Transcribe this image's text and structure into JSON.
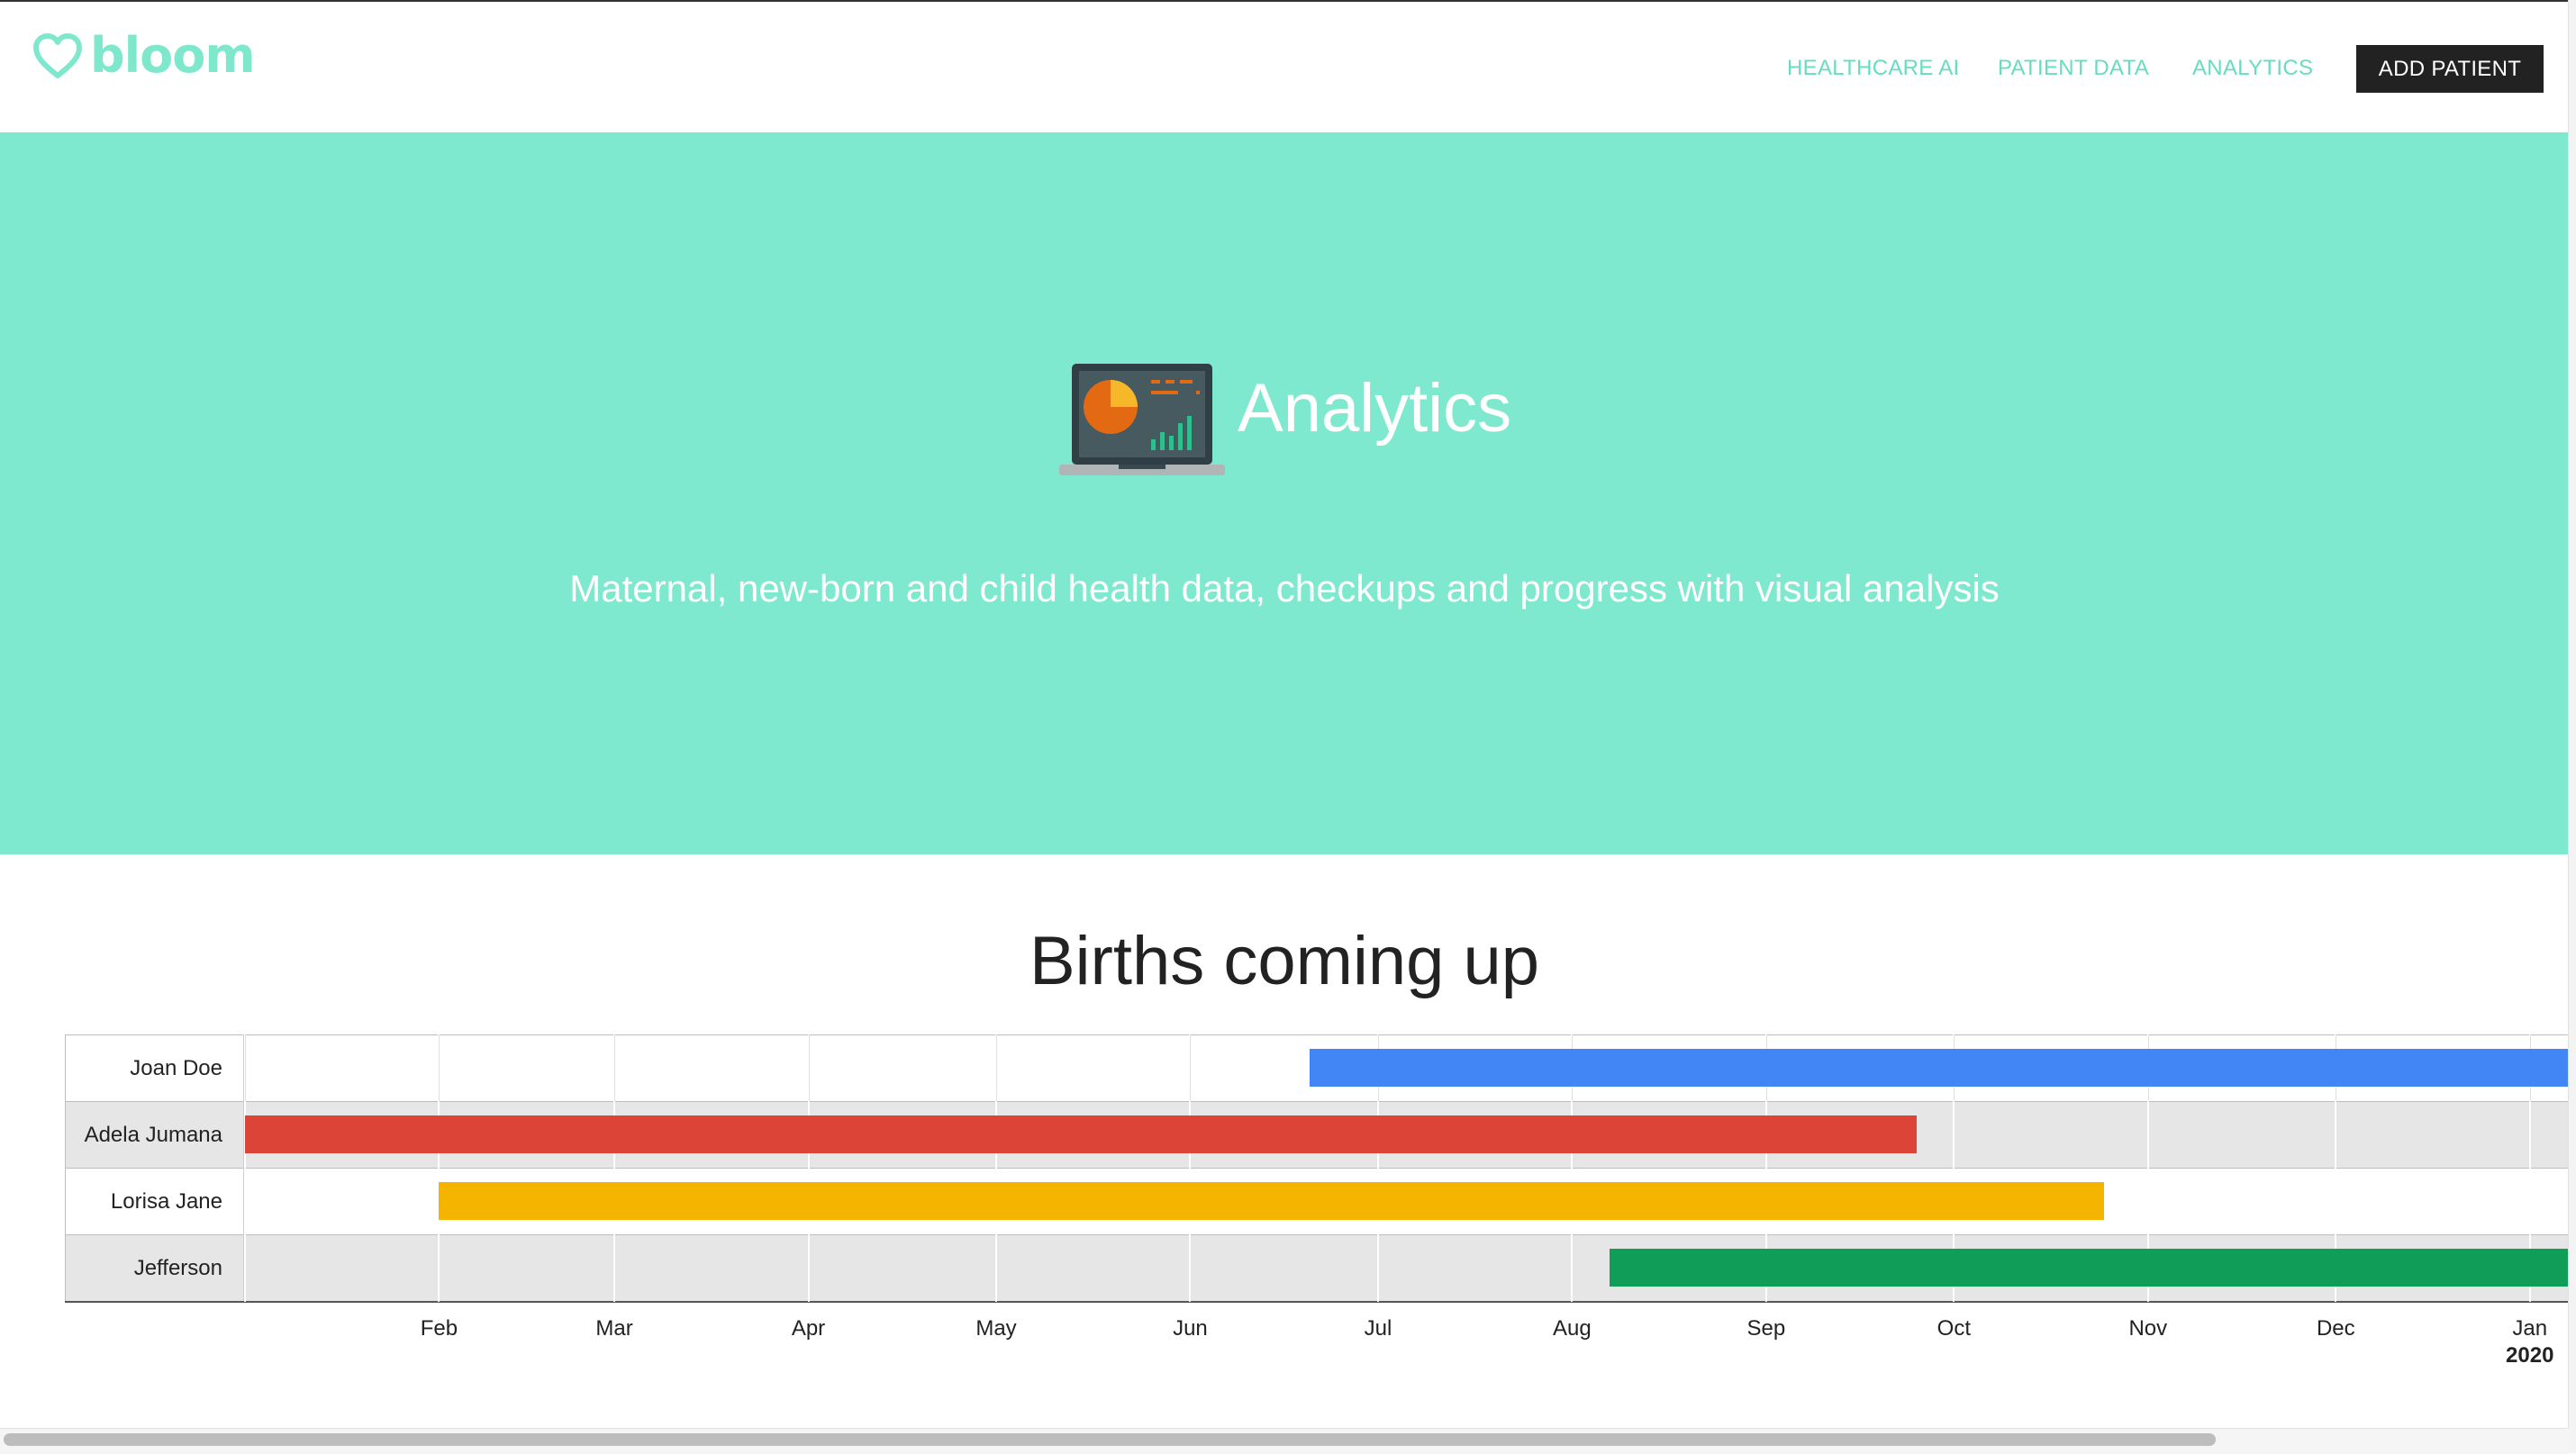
{
  "brand": {
    "name": "bloom",
    "color": "#7fe8cc"
  },
  "nav": {
    "links": [
      "HEALTHCARE AI",
      "PATIENT DATA",
      "ANALYTICS"
    ],
    "cta": "ADD PATIENT"
  },
  "hero": {
    "icon": "laptop-analytics-icon",
    "title": "Analytics",
    "subtitle": "Maternal, new-born and child health data, checkups and progress with visual analysis",
    "background": "#7ee9ce"
  },
  "section": {
    "title": "Births coming up"
  },
  "chart_data": {
    "type": "timeline",
    "title": "Births coming up",
    "x_axis": {
      "ticks": [
        "Feb",
        "Mar",
        "Apr",
        "May",
        "Jun",
        "Jul",
        "Aug",
        "Sep",
        "Oct",
        "Nov",
        "Dec",
        "Jan"
      ],
      "year_label": "2020",
      "range": [
        "2019-01-01",
        "2020-02-10"
      ]
    },
    "rows": [
      {
        "name": "Joan Doe",
        "start": "2019-06-20",
        "end": "2020-02-10",
        "color": "#4285f4"
      },
      {
        "name": "Adela Jumana",
        "start": "2019-01-01",
        "end": "2019-09-25",
        "color": "#db4437"
      },
      {
        "name": "Lorisa Jane",
        "start": "2019-02-01",
        "end": "2019-10-25",
        "color": "#f4b400"
      },
      {
        "name": "Jefferson",
        "start": "2019-08-07",
        "end": "2020-02-10",
        "color": "#0f9d58"
      }
    ]
  }
}
